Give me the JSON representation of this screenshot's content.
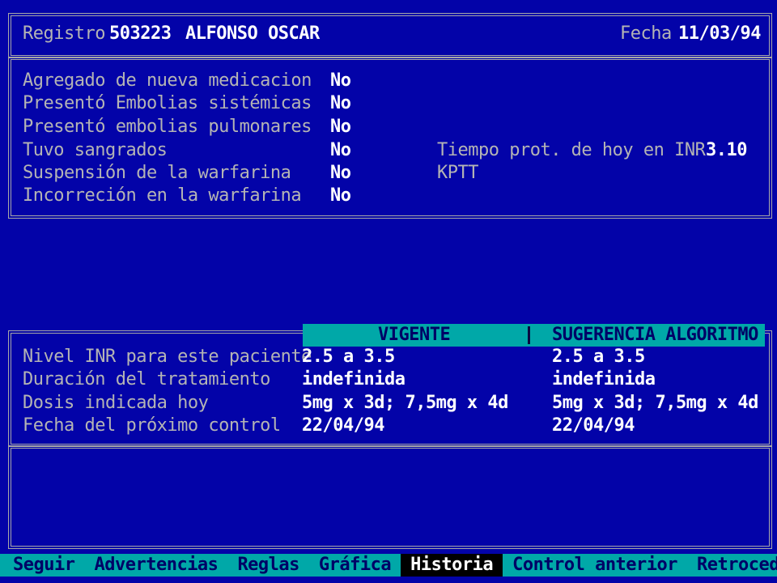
{
  "header": {
    "registro_label": "Registro",
    "registro_value": "503223",
    "patient_name": "ALFONSO OSCAR",
    "fecha_label": "Fecha",
    "fecha_value": "11/03/94"
  },
  "events": [
    {
      "label": "Agregado de nueva medicacion",
      "value": "No"
    },
    {
      "label": "Presentó Embolias sistémicas",
      "value": "No"
    },
    {
      "label": "Presentó embolias pulmonares",
      "value": "No"
    },
    {
      "label": "Tuvo sangrados",
      "value": "No"
    },
    {
      "label": "Suspensión de la warfarina",
      "value": "No"
    },
    {
      "label": "Incorreción en la warfarina",
      "value": "No"
    }
  ],
  "labs": {
    "inr_label": "Tiempo prot. de hoy en INR",
    "inr_value": "3.10",
    "kptt_label": "KPTT",
    "kptt_value": ""
  },
  "treatment": {
    "col_vigente": "VIGENTE",
    "col_sugerencia": "SUGERENCIA ALGORITMO",
    "rows": [
      {
        "label": "Nivel INR para este paciente",
        "vigente": "2.5 a 3.5",
        "sugerencia": "2.5 a 3.5"
      },
      {
        "label": "Duración del tratamiento",
        "vigente": "indefinida",
        "sugerencia": "indefinida"
      },
      {
        "label": "Dosis indicada hoy",
        "vigente": "5mg x 3d; 7,5mg x 4d",
        "sugerencia": "5mg x 3d; 7,5mg x 4d"
      },
      {
        "label": "Fecha del próximo control",
        "vigente": "22/04/94",
        "sugerencia": "22/04/94"
      }
    ]
  },
  "menu": {
    "items": [
      "Seguir",
      "Advertencias",
      "Reglas",
      "Gráfica",
      "Historia",
      "Control anterior",
      "Retroceder"
    ],
    "active": "Historia"
  },
  "colors": {
    "background": "#0303a8",
    "menu_bar": "#00a8a8",
    "label_text": "#b4b4b4",
    "value_text": "#ffffff"
  }
}
